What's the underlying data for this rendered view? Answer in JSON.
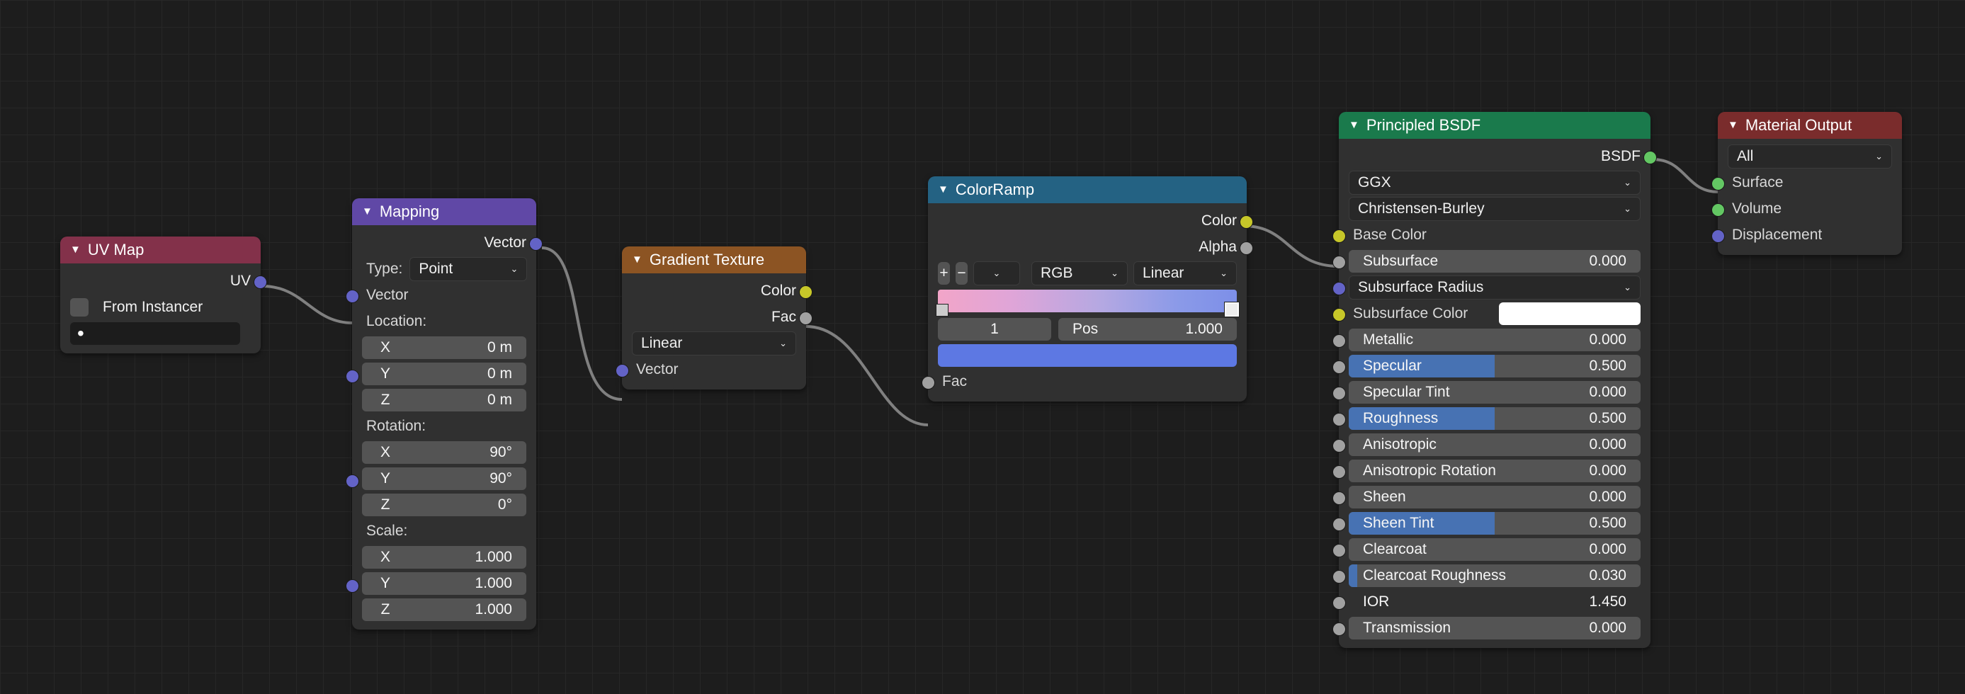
{
  "uvmap": {
    "title": "UV Map",
    "out_uv": "UV",
    "from_instancer": "From Instancer",
    "search_placeholder": ""
  },
  "mapping": {
    "title": "Mapping",
    "out_vector": "Vector",
    "type_label": "Type:",
    "type_value": "Point",
    "in_vector": "Vector",
    "location_label": "Location:",
    "loc": {
      "x_label": "X",
      "x_val": "0 m",
      "y_label": "Y",
      "y_val": "0 m",
      "z_label": "Z",
      "z_val": "0 m"
    },
    "rotation_label": "Rotation:",
    "rot": {
      "x_label": "X",
      "x_val": "90°",
      "y_label": "Y",
      "y_val": "90°",
      "z_label": "Z",
      "z_val": "0°"
    },
    "scale_label": "Scale:",
    "scl": {
      "x_label": "X",
      "x_val": "1.000",
      "y_label": "Y",
      "y_val": "1.000",
      "z_label": "Z",
      "z_val": "1.000"
    }
  },
  "gradient": {
    "title": "Gradient Texture",
    "out_color": "Color",
    "out_fac": "Fac",
    "mode": "Linear",
    "in_vector": "Vector"
  },
  "colorramp": {
    "title": "ColorRamp",
    "out_color": "Color",
    "out_alpha": "Alpha",
    "mode_color": "RGB",
    "mode_interp": "Linear",
    "index": "1",
    "pos_label": "Pos",
    "pos_val": "1.000",
    "in_fac": "Fac"
  },
  "bsdf": {
    "title": "Principled BSDF",
    "out_bsdf": "BSDF",
    "distribution": "GGX",
    "subsurf_method": "Christensen-Burley",
    "base_color": "Base Color",
    "inputs": [
      {
        "name": "Subsurface",
        "val": "0.000",
        "fill": 0
      },
      {
        "name": "Subsurface Radius",
        "val": "",
        "type": "dropdown"
      },
      {
        "name": "Subsurface Color",
        "val": "",
        "type": "swatch"
      },
      {
        "name": "Metallic",
        "val": "0.000",
        "fill": 0
      },
      {
        "name": "Specular",
        "val": "0.500",
        "fill": 0.5
      },
      {
        "name": "Specular Tint",
        "val": "0.000",
        "fill": 0
      },
      {
        "name": "Roughness",
        "val": "0.500",
        "fill": 0.5
      },
      {
        "name": "Anisotropic",
        "val": "0.000",
        "fill": 0
      },
      {
        "name": "Anisotropic Rotation",
        "val": "0.000",
        "fill": 0
      },
      {
        "name": "Sheen",
        "val": "0.000",
        "fill": 0
      },
      {
        "name": "Sheen Tint",
        "val": "0.500",
        "fill": 0.5
      },
      {
        "name": "Clearcoat",
        "val": "0.000",
        "fill": 0
      },
      {
        "name": "Clearcoat Roughness",
        "val": "0.030",
        "fill": 0.03
      },
      {
        "name": "IOR",
        "val": "1.450",
        "type": "plain"
      },
      {
        "name": "Transmission",
        "val": "0.000",
        "fill": 0
      }
    ]
  },
  "output": {
    "title": "Material Output",
    "target": "All",
    "surface": "Surface",
    "volume": "Volume",
    "displacement": "Displacement"
  }
}
